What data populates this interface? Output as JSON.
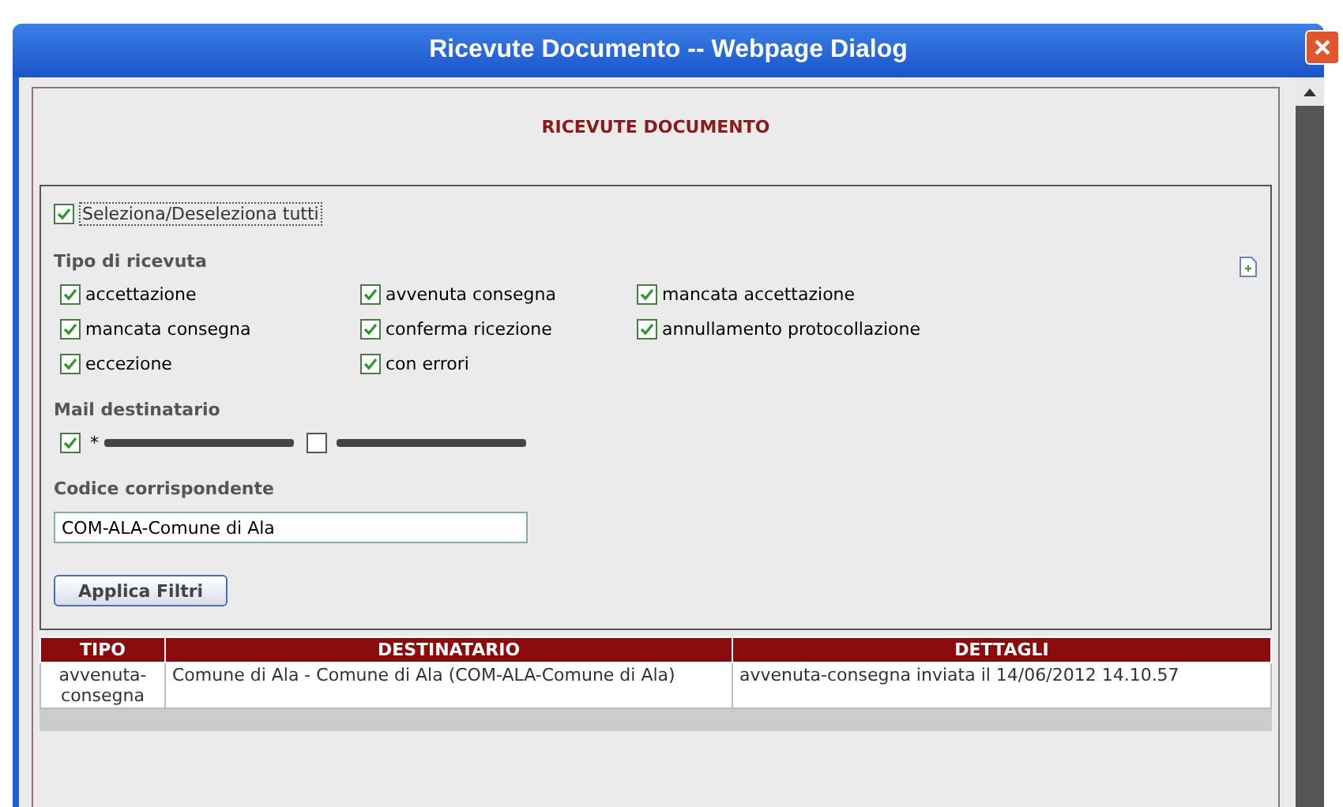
{
  "window": {
    "title": "Ricevute Documento -- Webpage Dialog"
  },
  "heading": "RICEVUTE DOCUMENTO",
  "select_all": {
    "label": "Seleziona/Deseleziona tutti",
    "checked": true
  },
  "receipt_type": {
    "label": "Tipo di ricevuta",
    "options": [
      {
        "label": "accettazione",
        "checked": true
      },
      {
        "label": "avvenuta consegna",
        "checked": true
      },
      {
        "label": "mancata accettazione",
        "checked": true
      },
      {
        "label": "mancata consegna",
        "checked": true
      },
      {
        "label": "conferma ricezione",
        "checked": true
      },
      {
        "label": "annullamento protocollazione",
        "checked": true
      },
      {
        "label": "eccezione",
        "checked": true
      },
      {
        "label": "con errori",
        "checked": true
      }
    ]
  },
  "recipient_mail": {
    "label": "Mail destinatario",
    "options": [
      {
        "prefix": "*",
        "checked": true
      },
      {
        "checked": false
      }
    ]
  },
  "correspondent_code": {
    "label": "Codice corrispondente",
    "value": "COM-ALA-Comune di Ala"
  },
  "apply_button": "Applica Filtri",
  "table": {
    "columns": [
      "TIPO",
      "DESTINATARIO",
      "DETTAGLI"
    ],
    "rows": [
      [
        "avvenuta-consegna",
        "Comune di Ala - Comune di Ala (COM-ALA-Comune di Ala)",
        "avvenuta-consegna inviata il 14/06/2012 14.10.57"
      ]
    ]
  }
}
